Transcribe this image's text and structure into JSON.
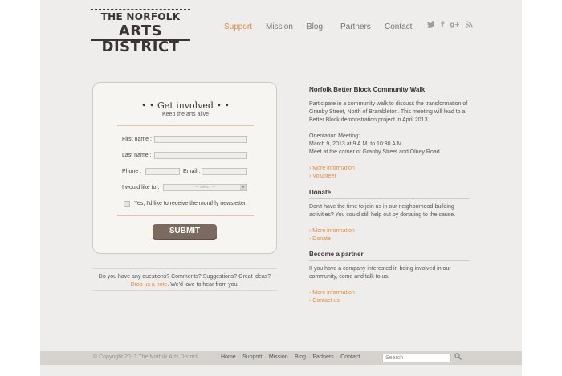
{
  "logo": {
    "line1": "THE NORFOLK",
    "line2": "ARTS DISTRICT"
  },
  "nav": [
    {
      "label": "Support",
      "active": true
    },
    {
      "label": "Mission",
      "active": false
    },
    {
      "label": "Blog",
      "active": false
    },
    {
      "label": "Partners",
      "active": false
    },
    {
      "label": "Contact",
      "active": false
    }
  ],
  "social": {
    "twitter": "twitter-icon",
    "facebook": "facebook-icon",
    "gplus": "google-plus-icon",
    "rss": "rss-icon"
  },
  "form": {
    "title": "• • Get involved • •",
    "subtitle": "Keep the arts alive",
    "first_name_label": "First name :",
    "last_name_label": "Last name :",
    "phone_label": "Phone  :",
    "email_label": "Email :",
    "would_like_label": "I would like to :",
    "select_value": "— select —",
    "newsletter_label": "Yes, I'd like to receive the monthly newsletter.",
    "submit_label": "SUBMIT"
  },
  "questions": {
    "line1": "Do you have any questions? Comments? Suggestions? Great ideas?",
    "link": "Drop us a note",
    "line2_rest": ". We'd love to hear from you!"
  },
  "sections": [
    {
      "title": "Norfolk Better Block Community Walk",
      "paragraphs": [
        "Participate in a community walk to discuss the transformation of Granby Street, North of Brambleton. This meeting will lead to a Better Block demonstration project in April 2013.",
        "Orientation Meeting:\nMarch 9, 2013 at 9 A.M. to 10:30 A.M.\nMeet at the corner of Granby Street and Olney Road"
      ],
      "links": [
        "More information",
        "Volunteer"
      ]
    },
    {
      "title": "Donate",
      "paragraphs": [
        "Don't have the time to join us in our neighborhood-building activities? You could still help out by donating to the cause."
      ],
      "links": [
        "More information",
        "Donate"
      ]
    },
    {
      "title": "Become a partner",
      "paragraphs": [
        "If you have a company interested in being involved in our community, come and talk to us."
      ],
      "links": [
        "More information",
        "Contact us"
      ]
    }
  ],
  "footer": {
    "copyright": "© Copyright 2013 The Norfolk Arts District",
    "nav": [
      "Home",
      "Support",
      "Mission",
      "Blog",
      "Partners",
      "Contact"
    ],
    "search_placeholder": "Search"
  },
  "colors": {
    "accent": "#e08a3c",
    "button": "#7c6a60",
    "background": "#eeedeb"
  }
}
